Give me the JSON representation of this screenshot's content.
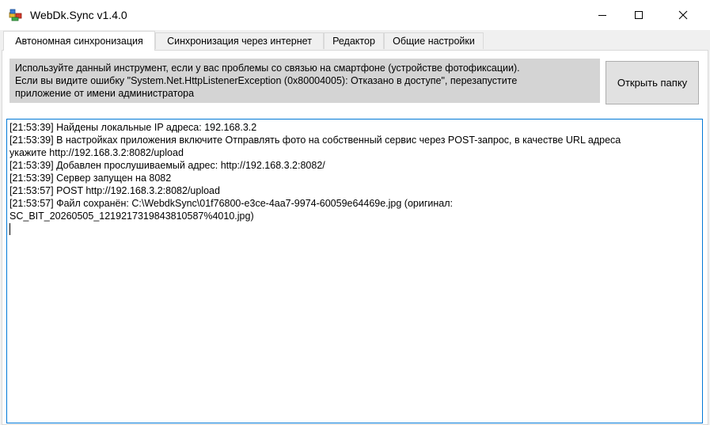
{
  "window": {
    "title": "WebDk.Sync v1.4.0",
    "app_icon": "app-logo-icon",
    "controls": {
      "minimize": "minimize-icon",
      "maximize": "maximize-icon",
      "close": "close-icon"
    }
  },
  "tabs": [
    {
      "label": "Автономная синхронизация",
      "active": true
    },
    {
      "label": "Синхронизация через интернет",
      "active": false
    },
    {
      "label": "Редактор",
      "active": false
    },
    {
      "label": "Общие настройки",
      "active": false
    }
  ],
  "offline_tab": {
    "info_lines": [
      "Используйте данный инструмент, если у вас проблемы со связью на смартфоне (устройстве фотофиксации).",
      "Если вы видите ошибку \"System.Net.HttpListenerException (0x80004005): Отказано в доступе\", перезапустите",
      "приложение от имени администратора"
    ],
    "open_folder_label": "Открыть папку",
    "log_lines": [
      "[21:53:39] Найдены локальные IP адреса: 192.168.3.2",
      "[21:53:39] В настройках приложения включите Отправлять фото на собственный сервис через POST-запрос, в качестве URL адреса",
      "укажите http://192.168.3.2:8082/upload",
      "[21:53:39] Добавлен прослушиваемый адрес: http://192.168.3.2:8082/",
      "[21:53:39] Сервер запущен на 8082",
      "[21:53:57] POST http://192.168.3.2:8082/upload",
      "[21:53:57] Файл сохранён: C:\\WebdkSync\\01f76800-e3ce-4aa7-9974-60059e64469e.jpg (оригинал:",
      "SC_BIT_20260505_1219217319843810587%4010.jpg)"
    ]
  },
  "colors": {
    "focus_border": "#0078d7",
    "info_background": "#d4d4d4",
    "window_background": "#f0f0f0"
  }
}
